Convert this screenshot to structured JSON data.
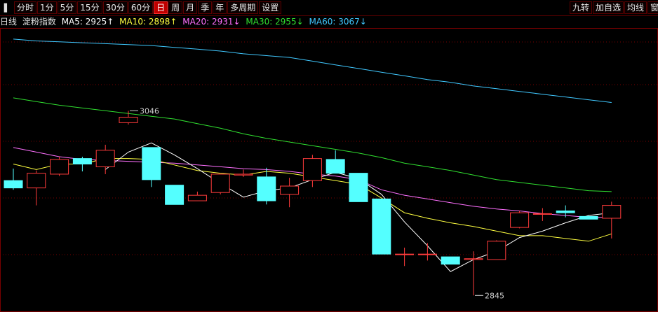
{
  "toolbar": {
    "left_buttons": [
      {
        "label": "分时",
        "active": false
      },
      {
        "label": "1分",
        "active": false
      },
      {
        "label": "5分",
        "active": false
      },
      {
        "label": "15分",
        "active": false
      },
      {
        "label": "30分",
        "active": false
      },
      {
        "label": "60分",
        "active": false
      },
      {
        "label": "日",
        "active": true
      },
      {
        "label": "周",
        "active": false
      },
      {
        "label": "月",
        "active": false
      },
      {
        "label": "季",
        "active": false
      },
      {
        "label": "年",
        "active": false
      },
      {
        "label": "多周期",
        "active": false
      },
      {
        "label": "设置",
        "active": false
      }
    ],
    "right_buttons": [
      {
        "label": "九转"
      },
      {
        "label": "加自选"
      },
      {
        "label": "均线"
      },
      {
        "label": "窗"
      }
    ]
  },
  "info": {
    "period": "日线",
    "name": "淀粉指数",
    "ma5": "MA5: 2925↑",
    "ma10": "MA10: 2898↑",
    "ma20": "MA20: 2931↓",
    "ma30": "MA30: 2955↓",
    "ma60": "MA60: 3067↓"
  },
  "colors": {
    "up": "#ff3b3b",
    "down": "#54ffff",
    "ma5": "#ffffff",
    "ma10": "#ffff40",
    "ma20": "#ff70ff",
    "ma30": "#30e030",
    "ma60": "#40c8ff",
    "grid": "#7a0000"
  },
  "chart_data": {
    "type": "candlestick",
    "ylim": [
      2830,
      3130
    ],
    "candles": [
      {
        "o": 2970,
        "c": 2962,
        "h": 2983,
        "l": 2960
      },
      {
        "o": 2962,
        "c": 2978,
        "h": 2981,
        "l": 2943
      },
      {
        "o": 2977,
        "c": 2993,
        "h": 2996,
        "l": 2975
      },
      {
        "o": 2994,
        "c": 2988,
        "h": 2996,
        "l": 2980
      },
      {
        "o": 2985,
        "c": 3003,
        "h": 3009,
        "l": 2977
      },
      {
        "o": 3033,
        "c": 3039,
        "h": 3046,
        "l": 3031
      },
      {
        "o": 3006,
        "c": 2971,
        "h": 3006,
        "l": 2963
      },
      {
        "o": 2965,
        "c": 2944,
        "h": 2965,
        "l": 2944
      },
      {
        "o": 2948,
        "c": 2954,
        "h": 2958,
        "l": 2948
      },
      {
        "o": 2957,
        "c": 2977,
        "h": 2977,
        "l": 2955
      },
      {
        "o": 2976,
        "c": 2977,
        "h": 2982,
        "l": 2974
      },
      {
        "o": 2974,
        "c": 2948,
        "h": 2984,
        "l": 2944
      },
      {
        "o": 2955,
        "c": 2964,
        "h": 2973,
        "l": 2941
      },
      {
        "o": 2970,
        "c": 2994,
        "h": 2998,
        "l": 2963
      },
      {
        "o": 2993,
        "c": 2978,
        "h": 3003,
        "l": 2978
      },
      {
        "o": 2978,
        "c": 2947,
        "h": 2978,
        "l": 2947
      },
      {
        "o": 2950,
        "c": 2890,
        "h": 2950,
        "l": 2890
      },
      {
        "o": 2890,
        "c": 2890,
        "h": 2897,
        "l": 2877
      },
      {
        "o": 2890,
        "c": 2890,
        "h": 2902,
        "l": 2883
      },
      {
        "o": 2887,
        "c": 2879,
        "h": 2887,
        "l": 2879
      },
      {
        "o": 2884,
        "c": 2885,
        "h": 2893,
        "l": 2845
      },
      {
        "o": 2884,
        "c": 2904,
        "h": 2905,
        "l": 2884
      },
      {
        "o": 2919,
        "c": 2935,
        "h": 2937,
        "l": 2918
      },
      {
        "o": 2934,
        "c": 2934,
        "h": 2940,
        "l": 2926
      },
      {
        "o": 2937,
        "c": 2935,
        "h": 2943,
        "l": 2930
      },
      {
        "o": 2931,
        "c": 2928,
        "h": 2932,
        "l": 2928
      },
      {
        "o": 2929,
        "c": 2943,
        "h": 2947,
        "l": 2907
      }
    ],
    "ma": {
      "ma5": [
        null,
        null,
        null,
        null,
        2982,
        3001,
        3011,
        2998,
        2983,
        2967,
        2952,
        2959,
        2962,
        2971,
        2979,
        2972,
        2955,
        2925,
        2899,
        2871,
        2884,
        2893,
        2908,
        2915,
        2924,
        2932,
        2935
      ],
      "ma10": [
        2988,
        2982,
        2988,
        2988,
        2994,
        2994,
        2993,
        2987,
        2981,
        2978,
        2976,
        2980,
        2978,
        2974,
        2970,
        2966,
        2951,
        2935,
        2929,
        2924,
        2920,
        2915,
        2910,
        2910,
        2907,
        2904,
        2912
      ],
      "ma20": [
        3006,
        3001,
        2996,
        2993,
        2992,
        2991,
        2990,
        2989,
        2987,
        2985,
        2983,
        2982,
        2980,
        2977,
        2975,
        2971,
        2960,
        2954,
        2950,
        2946,
        2942,
        2939,
        2937,
        2934,
        2932,
        2930,
        2930
      ],
      "ma30": [
        3060,
        3056,
        3052,
        3049,
        3046,
        3043,
        3040,
        3037,
        3032,
        3027,
        3021,
        3016,
        3012,
        3008,
        3004,
        3000,
        2995,
        2989,
        2985,
        2981,
        2976,
        2971,
        2968,
        2965,
        2962,
        2959,
        2958
      ],
      "ma60": [
        3124,
        3122,
        3121,
        3120,
        3119,
        3118,
        3117,
        3115,
        3113,
        3111,
        3108,
        3106,
        3104,
        3100,
        3096,
        3092,
        3088,
        3084,
        3080,
        3077,
        3073,
        3070,
        3067,
        3064,
        3061,
        3058,
        3055
      ]
    },
    "annotations": [
      {
        "text": "3046",
        "index": 5,
        "value": 3046
      },
      {
        "text": "2845",
        "index": 20,
        "value": 2845
      }
    ]
  }
}
